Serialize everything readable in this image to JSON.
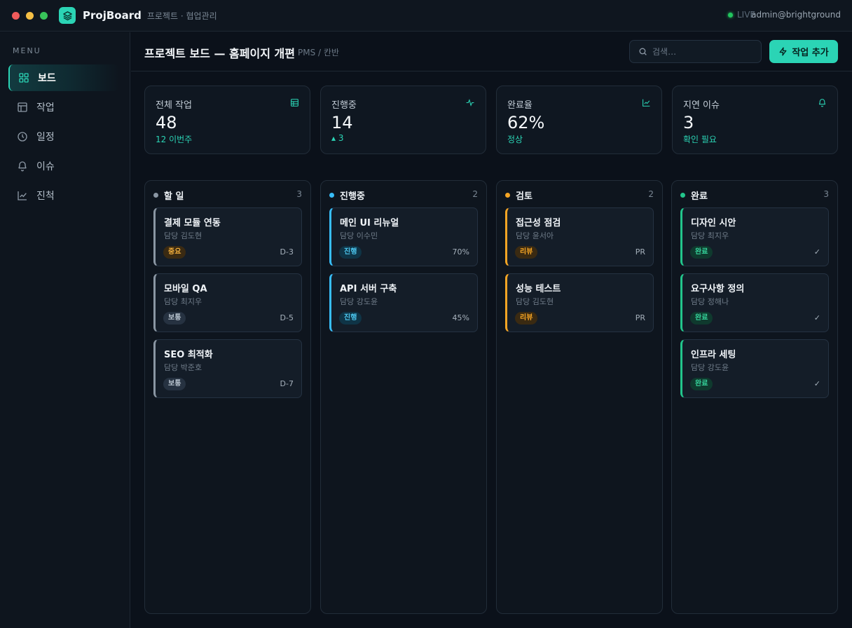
{
  "app": {
    "name": "ProjBoard",
    "subtitle": "프로젝트 · 협업관리",
    "live_label": "LIVE",
    "user": "admin@brightground"
  },
  "sidebar": {
    "heading": "MENU",
    "items": [
      {
        "label": "보드",
        "icon": "grid-icon",
        "active": true
      },
      {
        "label": "작업",
        "icon": "table-icon",
        "active": false
      },
      {
        "label": "일정",
        "icon": "clock-icon",
        "active": false
      },
      {
        "label": "이슈",
        "icon": "bell-icon",
        "active": false
      },
      {
        "label": "진척",
        "icon": "chart-icon",
        "active": false
      }
    ]
  },
  "header": {
    "title": "프로젝트 보드 — 홈페이지 개편",
    "crumb": "PMS / 칸반",
    "search_placeholder": "검색…",
    "add_label": "작업 추가"
  },
  "stats": [
    {
      "label": "전체 작업",
      "value": "48",
      "sub": "12 이번주",
      "icon": "table-icon"
    },
    {
      "label": "진행중",
      "value": "14",
      "sub": "▴ 3",
      "icon": "pulse-icon"
    },
    {
      "label": "완료율",
      "value": "62%",
      "sub": "정상",
      "icon": "chart-icon"
    },
    {
      "label": "지연 이슈",
      "value": "3",
      "sub": "확인 필요",
      "icon": "bell-icon"
    }
  ],
  "columns": [
    {
      "title": "할 일",
      "count": "3",
      "color": "#8a96a3",
      "cards": [
        {
          "title": "결제 모듈 연동",
          "owner": "담당 김도현",
          "tag": "중요",
          "meta": "D-3"
        },
        {
          "title": "모바일 QA",
          "owner": "담당 최지우",
          "tag": "보통",
          "meta": "D-5"
        },
        {
          "title": "SEO 최적화",
          "owner": "담당 박준호",
          "tag": "보통",
          "meta": "D-7"
        }
      ]
    },
    {
      "title": "진행중",
      "count": "2",
      "color": "#38bdf8",
      "cards": [
        {
          "title": "메인 UI 리뉴얼",
          "owner": "담당 이수민",
          "tag": "진행",
          "meta": "70%"
        },
        {
          "title": "API 서버 구축",
          "owner": "담당 강도윤",
          "tag": "진행",
          "meta": "45%"
        }
      ]
    },
    {
      "title": "검토",
      "count": "2",
      "color": "#f5a524",
      "cards": [
        {
          "title": "접근성 점검",
          "owner": "담당 윤서아",
          "tag": "리뷰",
          "meta": "PR"
        },
        {
          "title": "성능 테스트",
          "owner": "담당 김도현",
          "tag": "리뷰",
          "meta": "PR"
        }
      ]
    },
    {
      "title": "완료",
      "count": "3",
      "color": "#22c58b",
      "cards": [
        {
          "title": "디자인 시안",
          "owner": "담당 최지우",
          "tag": "완료",
          "meta": "✓"
        },
        {
          "title": "요구사항 정의",
          "owner": "담당 정해나",
          "tag": "완료",
          "meta": "✓"
        },
        {
          "title": "인프라 세팅",
          "owner": "담당 강도윤",
          "tag": "완료",
          "meta": "✓"
        }
      ]
    }
  ]
}
